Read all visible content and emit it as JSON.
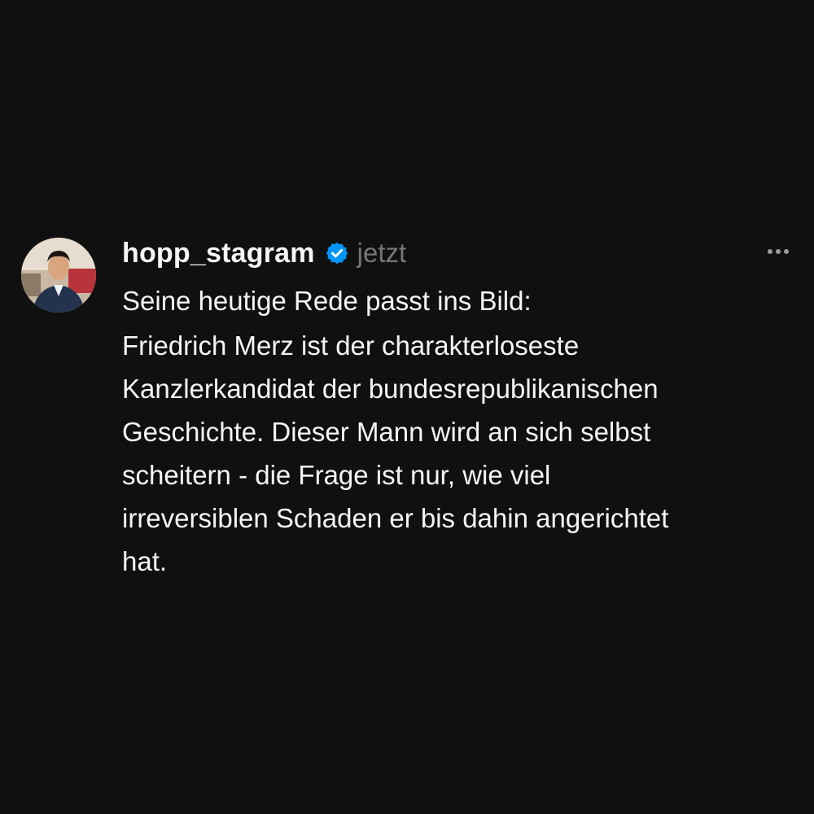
{
  "post": {
    "username": "hopp_stagram",
    "timestamp": "jetzt",
    "first_line": "Seine heutige Rede passt ins Bild:",
    "body": "Friedrich Merz ist der charakterloseste\nKanzlerkandidat der bundesrepublikanischen\nGeschichte. Dieser Mann wird an sich selbst\nscheitern - die Frage ist nur, wie viel\nirreversiblen Schaden er bis dahin angerichtet\nhat."
  },
  "icons": {
    "verified": "verified-badge-icon",
    "more": "more-options-icon"
  },
  "colors": {
    "background": "#101010",
    "text": "#f3f5f7",
    "muted": "#777777",
    "verified": "#0095f6"
  }
}
